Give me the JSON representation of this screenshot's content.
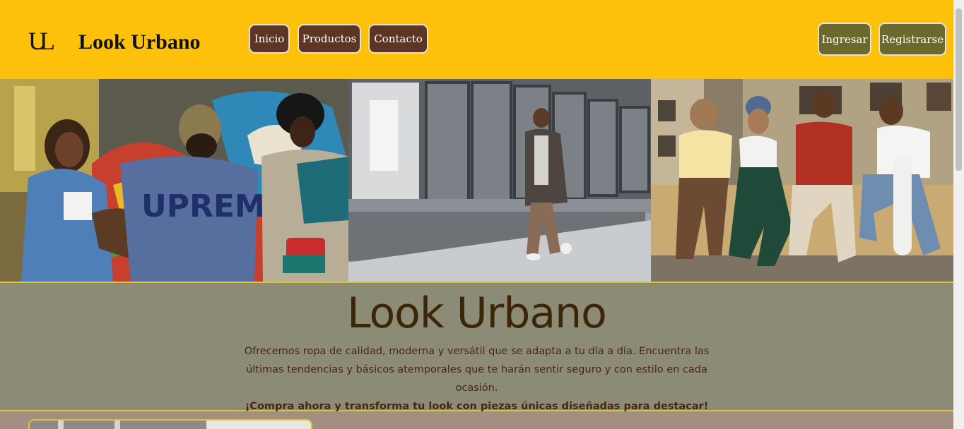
{
  "header": {
    "logo_mark": "UL",
    "brand": "Look Urbano",
    "nav": [
      "Inicio",
      "Productos",
      "Contacto"
    ],
    "auth": {
      "login": "Ingresar",
      "register": "Registrarse"
    }
  },
  "hero_images": [
    "street-group-graffiti",
    "man-walking-glass-building",
    "friends-sitting-wall"
  ],
  "intro": {
    "title": "Look Urbano",
    "text": "Ofrecemos ropa de calidad, moderna y versátil que se adapta a tu día a día. Encuentra las últimas tendencias y básicos atemporales que te harán sentir seguro y con estilo en cada ocasión.",
    "cta": "¡Compra ahora y transforma tu look con piezas únicas diseñadas para destacar!"
  },
  "colors": {
    "header_bg": "#fdc10c",
    "nav_btn": "#5d3524",
    "auth_btn": "#6a6a2d",
    "intro_bg": "#8b8b76",
    "border_accent": "#d6c637"
  }
}
